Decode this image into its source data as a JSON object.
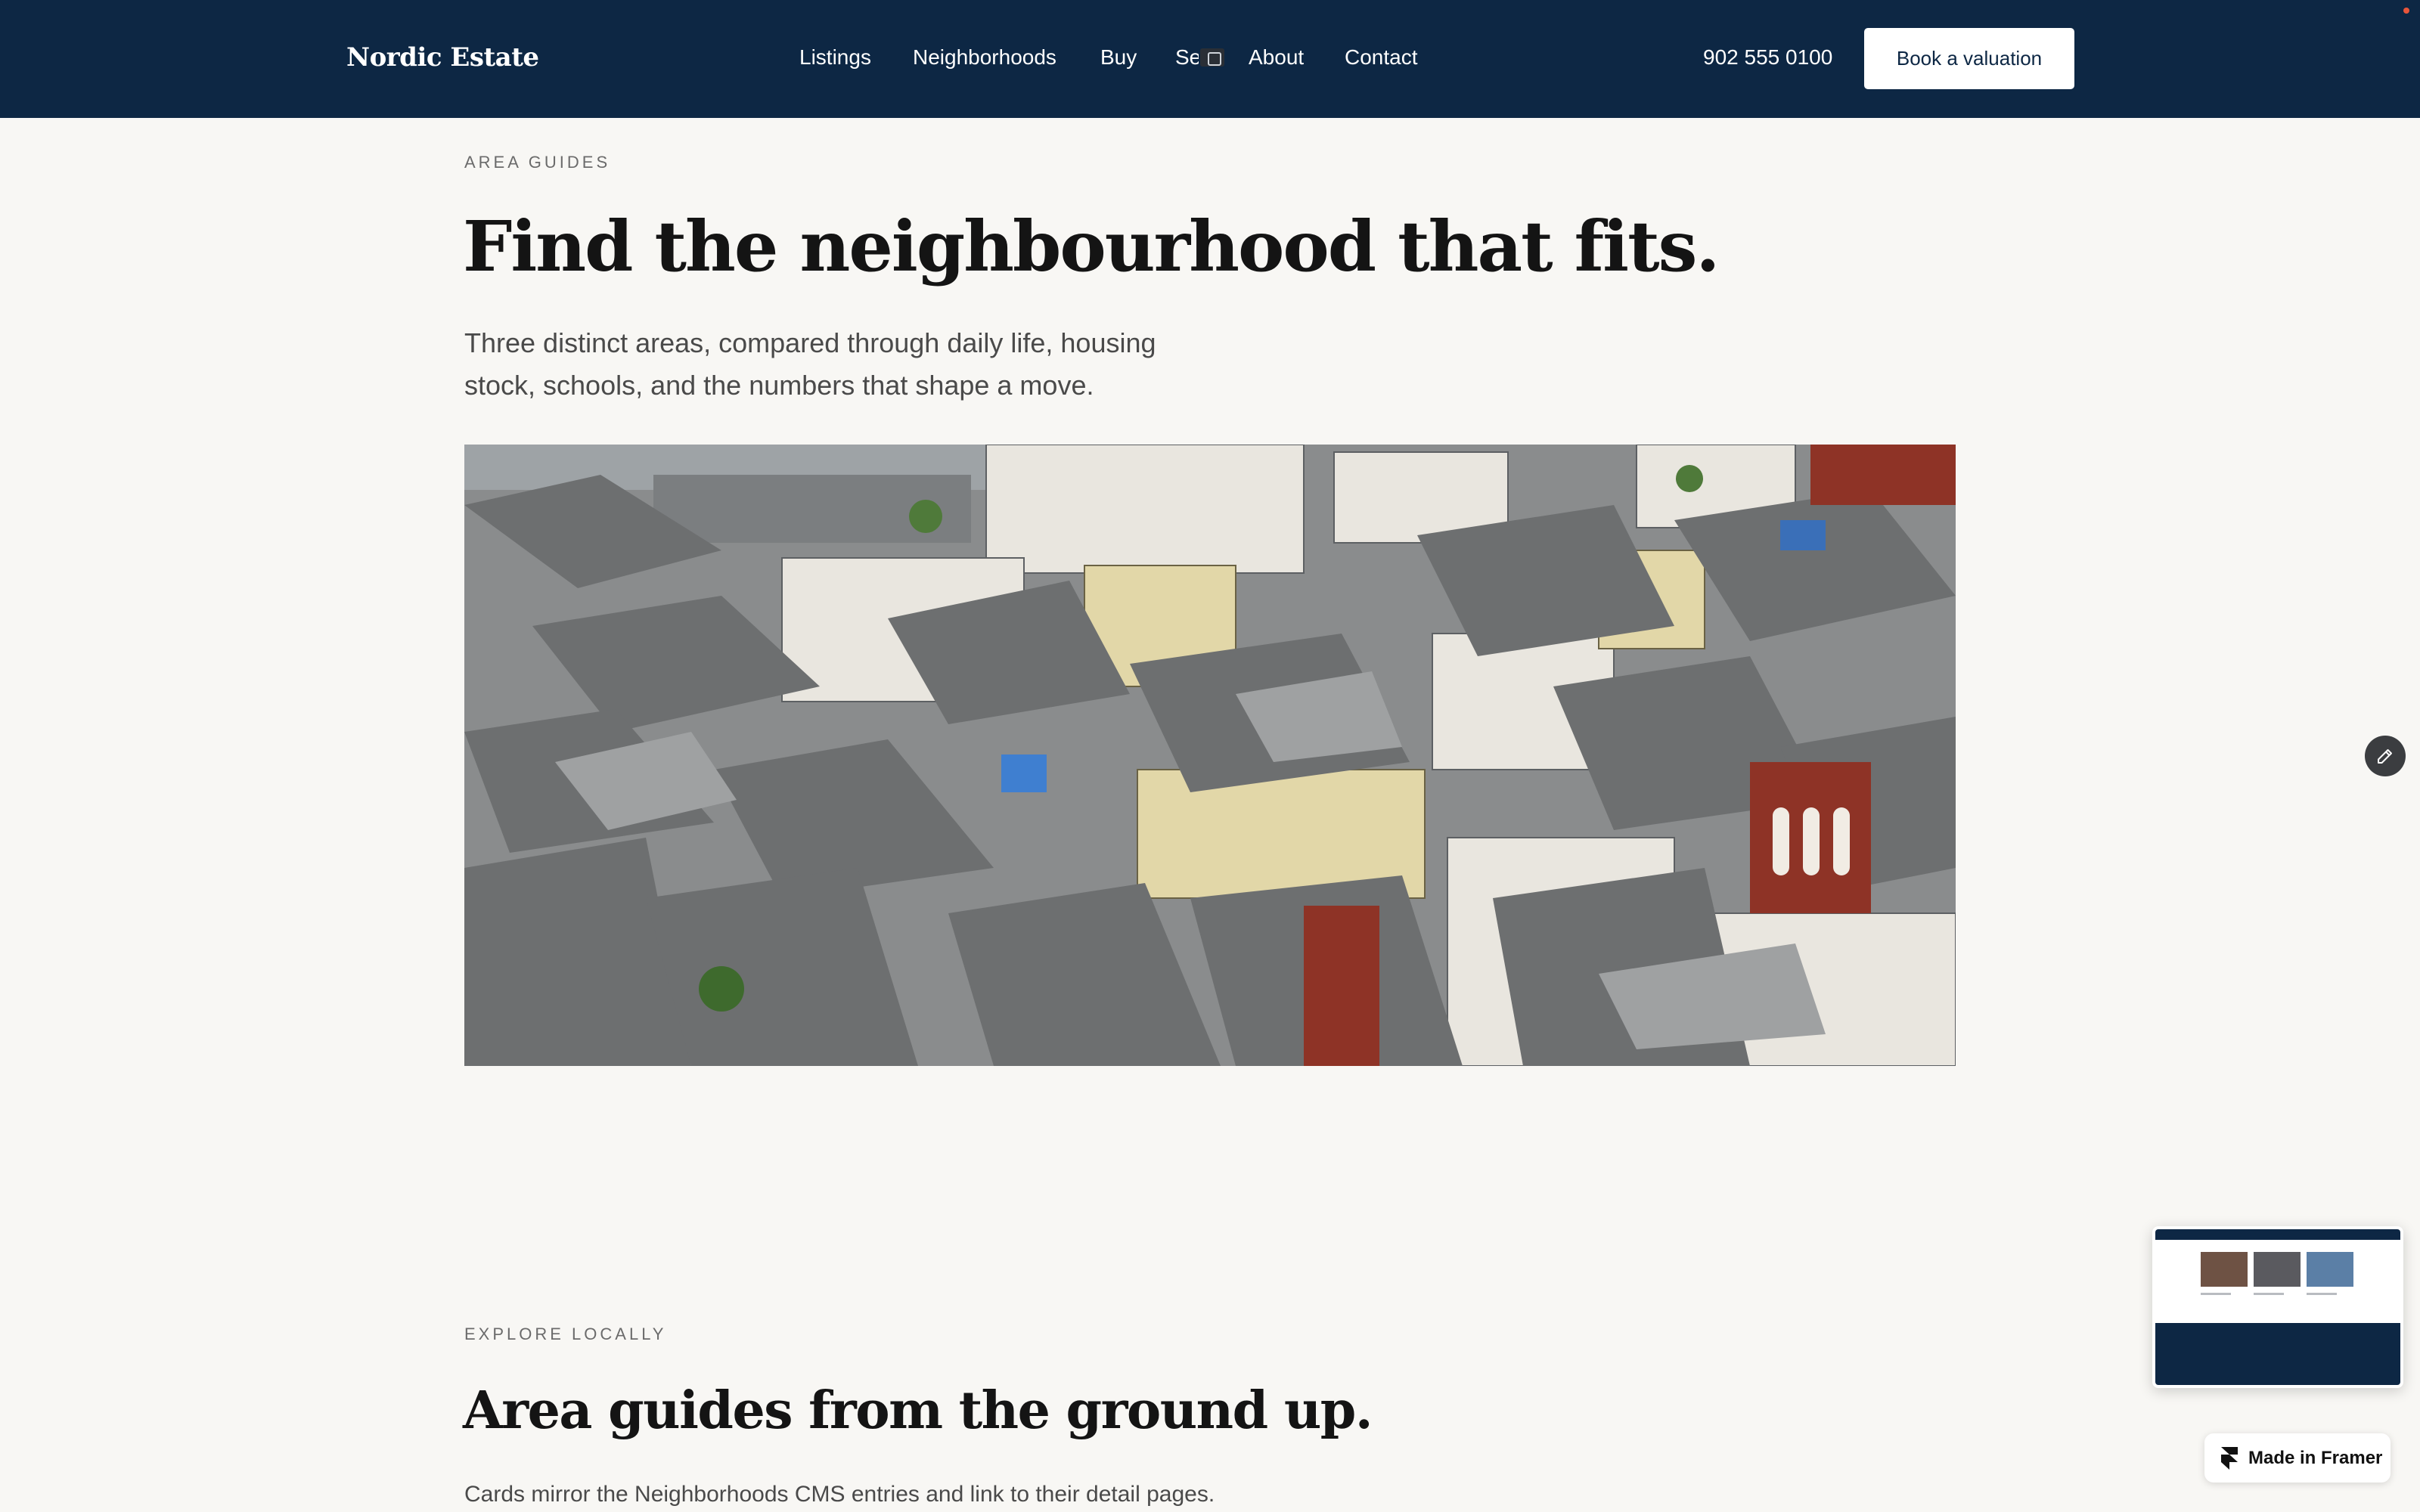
{
  "header": {
    "brand": "Nordic Estate",
    "nav": [
      "Listings",
      "Neighborhoods",
      "Buy",
      "Se",
      "About",
      "Contact"
    ],
    "phone": "902 555 0100",
    "cta_label": "Book a valuation"
  },
  "hero": {
    "eyebrow": "AREA GUIDES",
    "title": "Find the neighbourhood that fits.",
    "lead": "Three distinct areas, compared through daily life, housing stock, schools, and the numbers that shape a move.",
    "image_icon": "aerial-city-photo"
  },
  "section": {
    "eyebrow": "EXPLORE LOCALLY",
    "title": "Area guides from the ground up.",
    "body": "Cards mirror the Neighborhoods CMS entries and link to their detail pages."
  },
  "badge": {
    "label": "Made in Framer"
  },
  "colors": {
    "header_bg": "#0d2744",
    "page_bg": "#f8f7f4",
    "text_dark": "#141414",
    "text_muted": "#4a4a4a"
  }
}
